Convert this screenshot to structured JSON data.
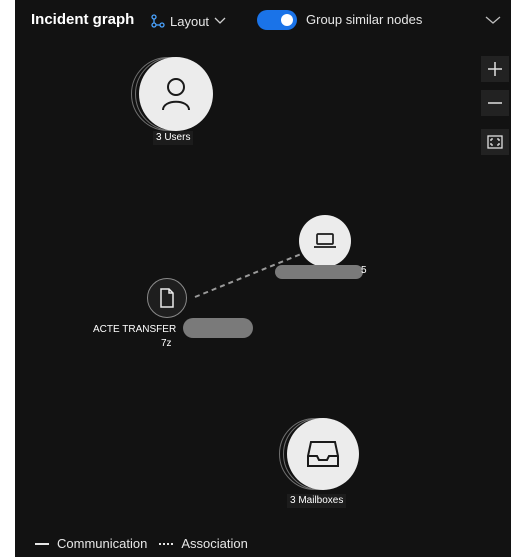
{
  "header": {
    "title": "Incident graph",
    "layout_label": "Layout",
    "group_toggle": {
      "label": "Group similar nodes",
      "on": true
    }
  },
  "zoom": {
    "zoom_in_icon": "plus-icon",
    "zoom_out_icon": "minus-icon",
    "fit_icon": "fit-to-screen-icon"
  },
  "nodes": {
    "users": {
      "label": "3 Users",
      "icon": "user-icon"
    },
    "device": {
      "label": "5",
      "icon": "laptop-icon"
    },
    "file": {
      "label_line1": "ACTE TRANSFER",
      "label_line2": "7z",
      "icon": "file-icon"
    },
    "mailboxes": {
      "label": "3 Mailboxes",
      "icon": "inbox-icon"
    }
  },
  "legend": {
    "communication": "Communication",
    "association": "Association"
  },
  "colors": {
    "background": "#121212",
    "accent": "#1a73e8",
    "node_fill": "#ececec"
  }
}
